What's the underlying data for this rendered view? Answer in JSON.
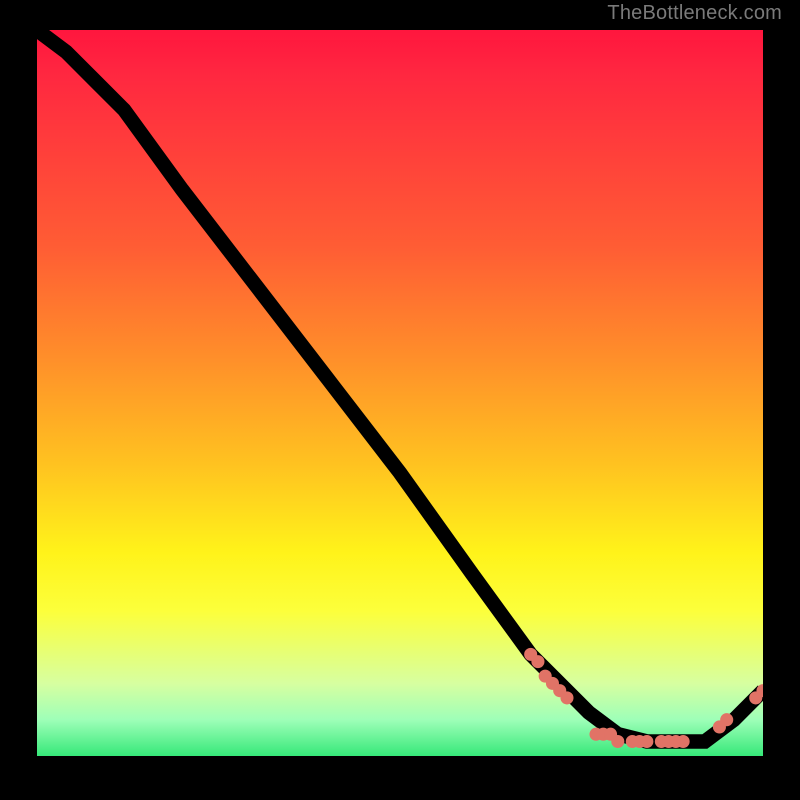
{
  "attribution": "TheBottleneck.com",
  "chart_data": {
    "type": "line",
    "title": "",
    "xlabel": "",
    "ylabel": "",
    "xlim": [
      0,
      100
    ],
    "ylim": [
      0,
      100
    ],
    "series": [
      {
        "name": "curve",
        "x": [
          0,
          4,
          8,
          12,
          20,
          30,
          40,
          50,
          60,
          68,
          72,
          76,
          80,
          84,
          88,
          92,
          96,
          100
        ],
        "y": [
          100,
          97,
          93,
          89,
          78,
          65,
          52,
          39,
          25,
          14,
          10,
          6,
          3,
          2,
          2,
          2,
          5,
          9
        ]
      }
    ],
    "markers": [
      {
        "x": 68,
        "y": 14
      },
      {
        "x": 69,
        "y": 13
      },
      {
        "x": 70,
        "y": 11
      },
      {
        "x": 71,
        "y": 10
      },
      {
        "x": 72,
        "y": 9
      },
      {
        "x": 73,
        "y": 8
      },
      {
        "x": 77,
        "y": 3
      },
      {
        "x": 78,
        "y": 3
      },
      {
        "x": 79,
        "y": 3
      },
      {
        "x": 80,
        "y": 2
      },
      {
        "x": 82,
        "y": 2
      },
      {
        "x": 83,
        "y": 2
      },
      {
        "x": 84,
        "y": 2
      },
      {
        "x": 86,
        "y": 2
      },
      {
        "x": 87,
        "y": 2
      },
      {
        "x": 88,
        "y": 2
      },
      {
        "x": 89,
        "y": 2
      },
      {
        "x": 94,
        "y": 4
      },
      {
        "x": 95,
        "y": 5
      },
      {
        "x": 99,
        "y": 8
      },
      {
        "x": 100,
        "y": 9
      }
    ]
  }
}
